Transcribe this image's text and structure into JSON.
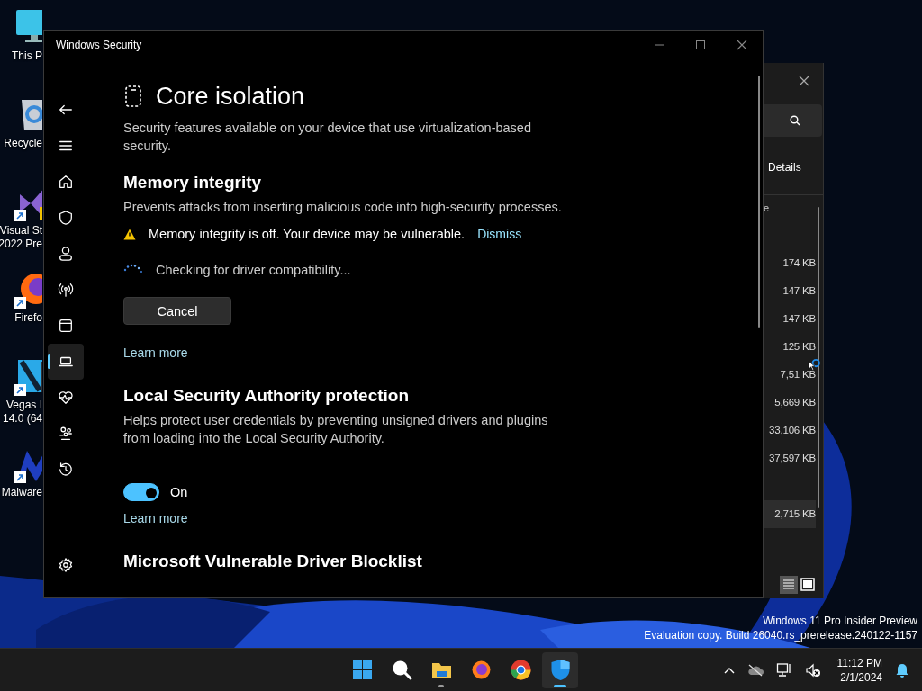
{
  "desktop_icons": [
    {
      "kind": "pc",
      "shortcut": false,
      "lines": [
        "This P"
      ]
    },
    {
      "kind": "bin",
      "shortcut": false,
      "lines": [
        "Recycle"
      ]
    },
    {
      "kind": "studio",
      "shortcut": true,
      "lines": [
        "Visual St",
        "2022 Pre"
      ]
    },
    {
      "kind": "firefox",
      "shortcut": true,
      "lines": [
        "Firefo"
      ]
    },
    {
      "kind": "vegas",
      "shortcut": true,
      "lines": [
        "Vegas I",
        "14.0 (64"
      ]
    },
    {
      "kind": "malware",
      "shortcut": true,
      "lines": [
        "Malware"
      ]
    }
  ],
  "background_window": {
    "tab": "Details",
    "column_1": "e",
    "rows": [
      {
        "size": "174 KB",
        "selected": false
      },
      {
        "size": "147 KB",
        "selected": false
      },
      {
        "size": "147 KB",
        "selected": false
      },
      {
        "size": "125 KB",
        "selected": false
      },
      {
        "size": "7,51 KB",
        "selected": false
      },
      {
        "size": "5,669 KB",
        "selected": false
      },
      {
        "size": "33,106 KB",
        "selected": false
      },
      {
        "size": "37,597 KB",
        "selected": false
      },
      {
        "size": "2,715 KB",
        "selected": true
      }
    ]
  },
  "security_window": {
    "title": "Windows Security",
    "sidebar": {
      "items": [
        {
          "kind": "back",
          "selected": false
        },
        {
          "kind": "menu",
          "selected": false
        },
        {
          "kind": "home",
          "selected": false
        },
        {
          "kind": "shield",
          "selected": false
        },
        {
          "kind": "person",
          "selected": false
        },
        {
          "kind": "wireless",
          "selected": false
        },
        {
          "kind": "browser",
          "selected": false
        },
        {
          "kind": "laptop",
          "selected": true
        },
        {
          "kind": "heart",
          "selected": false
        },
        {
          "kind": "family",
          "selected": false
        },
        {
          "kind": "history",
          "selected": false
        }
      ],
      "settings": {
        "kind": "settings",
        "selected": false
      }
    },
    "page": {
      "title": "Core isolation",
      "description": "Security features available on your device that use virtualization-based security.",
      "sections": [
        {
          "title": "Memory integrity",
          "description": "Prevents attacks from inserting malicious code into high-security processes.",
          "warning": {
            "text": "Memory integrity is off. Your device may be vulnerable.",
            "action": "Dismiss"
          },
          "progress": "Checking for driver compatibility...",
          "button": "Cancel",
          "link": "Learn more"
        },
        {
          "title": "Local Security Authority protection",
          "description": "Helps protect user credentials by preventing unsigned drivers and plugins from loading into the Local Security Authority.",
          "toggle": {
            "on": true,
            "label": "On"
          },
          "link": "Learn more"
        },
        {
          "title": "Microsoft Vulnerable Driver Blocklist"
        }
      ]
    }
  },
  "watermark": [
    "Windows 11 Pro Insider Preview",
    "Evaluation copy. Build 26040.rs_prerelease.240122-1157"
  ],
  "taskbar": {
    "apps": [
      {
        "kind": "start",
        "running": false,
        "selected": false
      },
      {
        "kind": "search",
        "running": false,
        "selected": false
      },
      {
        "kind": "explorer",
        "running": true,
        "selected": false
      },
      {
        "kind": "firefox",
        "running": false,
        "selected": false
      },
      {
        "kind": "chrome",
        "running": false,
        "selected": false
      },
      {
        "kind": "security",
        "running": true,
        "selected": true
      }
    ],
    "time": "11:12 PM",
    "date": "2/1/2024"
  }
}
